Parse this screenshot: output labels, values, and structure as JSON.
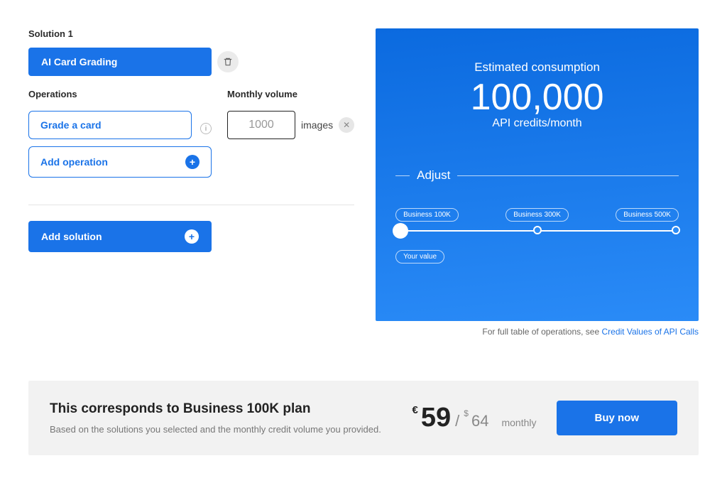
{
  "solution": {
    "label": "Solution 1",
    "name": "AI Card Grading"
  },
  "operations": {
    "label": "Operations",
    "items": [
      {
        "name": "Grade a card"
      }
    ],
    "add_label": "Add operation"
  },
  "volume": {
    "label": "Monthly volume",
    "value": "1000",
    "unit": "images"
  },
  "add_solution_label": "Add solution",
  "consumption": {
    "title": "Estimated consumption",
    "value": "100,000",
    "unit": "API credits/month",
    "adjust_label": "Adjust",
    "tiers": [
      "Business 100K",
      "Business 300K",
      "Business 500K"
    ],
    "your_value_label": "Your value"
  },
  "footer_link": {
    "prefix": "For full table of operations, see ",
    "link_text": "Credit Values of API Calls"
  },
  "plan_strip": {
    "title": "This corresponds to Business 100K plan",
    "sub": "Based on the solutions you selected and the monthly credit volume you provided.",
    "eur_sym": "€",
    "eur_price": "59",
    "slash": "/",
    "usd_sym": "$",
    "usd_price": "64",
    "period": "monthly",
    "buy_label": "Buy now"
  }
}
